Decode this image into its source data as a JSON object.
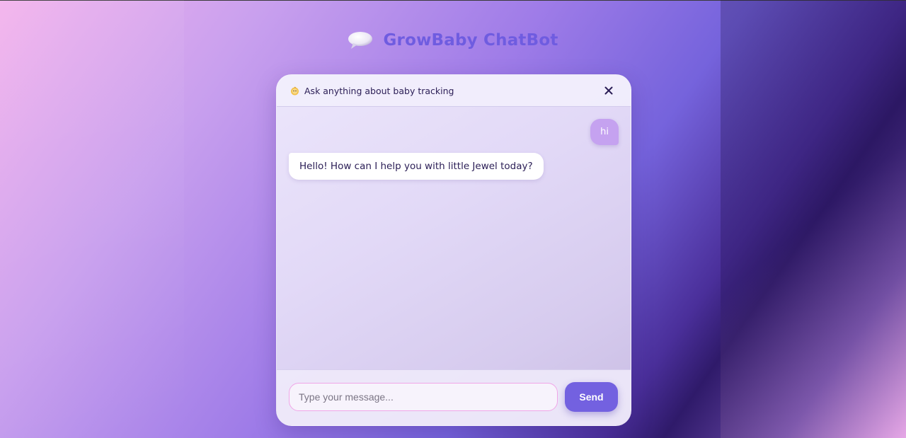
{
  "app": {
    "title": "GrowBaby ChatBot",
    "logo_icon": "speech-bubble-icon"
  },
  "chat": {
    "header_icon": "baby-icon",
    "header_title": "Ask anything about baby tracking",
    "close_icon": "close-icon",
    "messages": [
      {
        "role": "user",
        "text": "hi"
      },
      {
        "role": "bot",
        "text": "Hello! How can I help you with little Jewel today?"
      }
    ],
    "input": {
      "value": "",
      "placeholder": "Type your message..."
    },
    "send_label": "Send"
  },
  "colors": {
    "accent": "#7361e0",
    "title": "#6f5ce0",
    "user_bubble": "#c5a2f0",
    "input_border": "#f0a6e8"
  }
}
